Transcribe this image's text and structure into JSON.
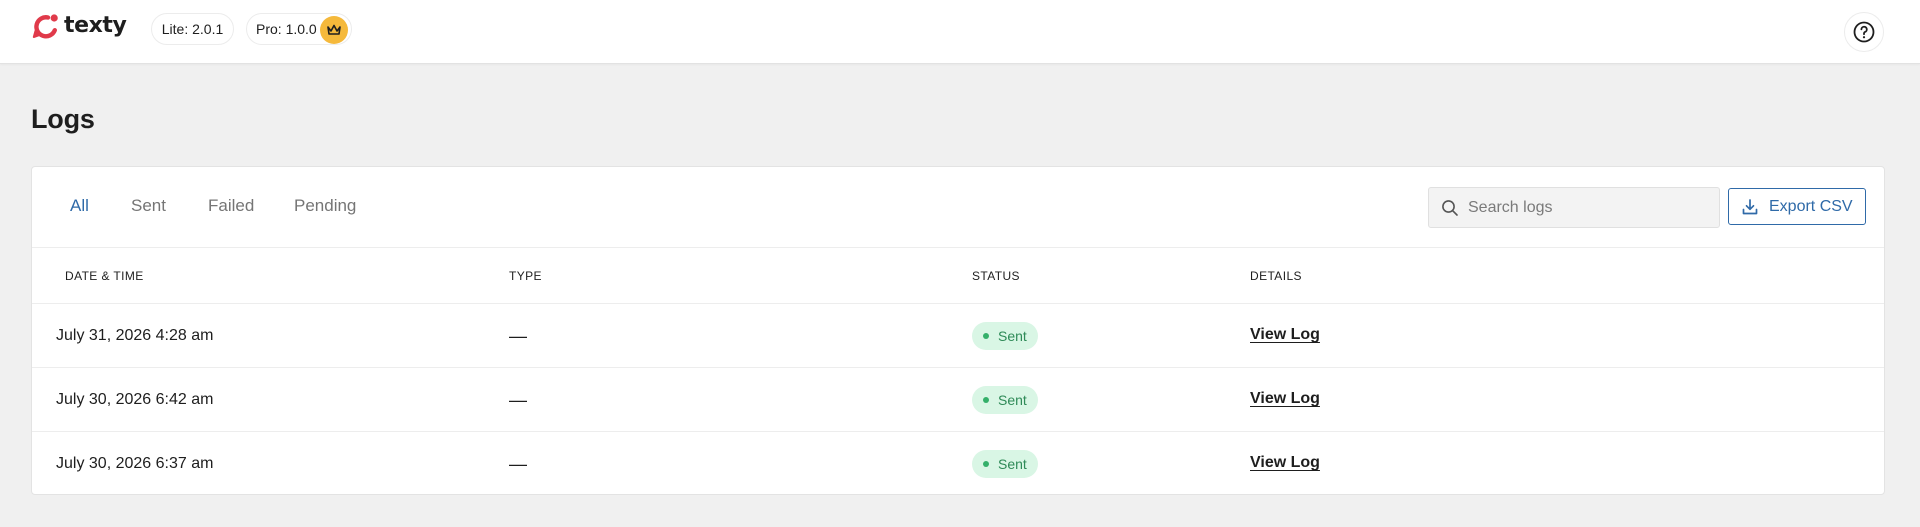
{
  "brand": {
    "name": "texty",
    "logo_icon": "texty-logo-icon",
    "accent_color": "#e03a4a"
  },
  "versions": {
    "lite": "Lite: 2.0.1",
    "pro": "Pro: 1.0.0",
    "pro_icon": "crown-icon"
  },
  "header": {
    "help_icon": "help-icon"
  },
  "page": {
    "title": "Logs"
  },
  "tabs": [
    {
      "label": "All",
      "active": true
    },
    {
      "label": "Sent",
      "active": false
    },
    {
      "label": "Failed",
      "active": false
    },
    {
      "label": "Pending",
      "active": false
    }
  ],
  "search": {
    "placeholder": "Search logs",
    "value": ""
  },
  "export": {
    "label": "Export CSV"
  },
  "table": {
    "columns": [
      "DATE & TIME",
      "TYPE",
      "STATUS",
      "DETAILS"
    ],
    "rows": [
      {
        "datetime": "July 31, 2026 4:28 am",
        "type": "—",
        "status": "Sent",
        "details": "View Log"
      },
      {
        "datetime": "July 30, 2026 6:42 am",
        "type": "—",
        "status": "Sent",
        "details": "View Log"
      },
      {
        "datetime": "July 30, 2026 6:37 am",
        "type": "—",
        "status": "Sent",
        "details": "View Log"
      }
    ]
  },
  "colors": {
    "tab_active": "#2f6aa8",
    "status_sent_bg": "#d9f6e5",
    "status_sent_text": "#2e8a57",
    "crown_bg": "#f5b93b"
  }
}
